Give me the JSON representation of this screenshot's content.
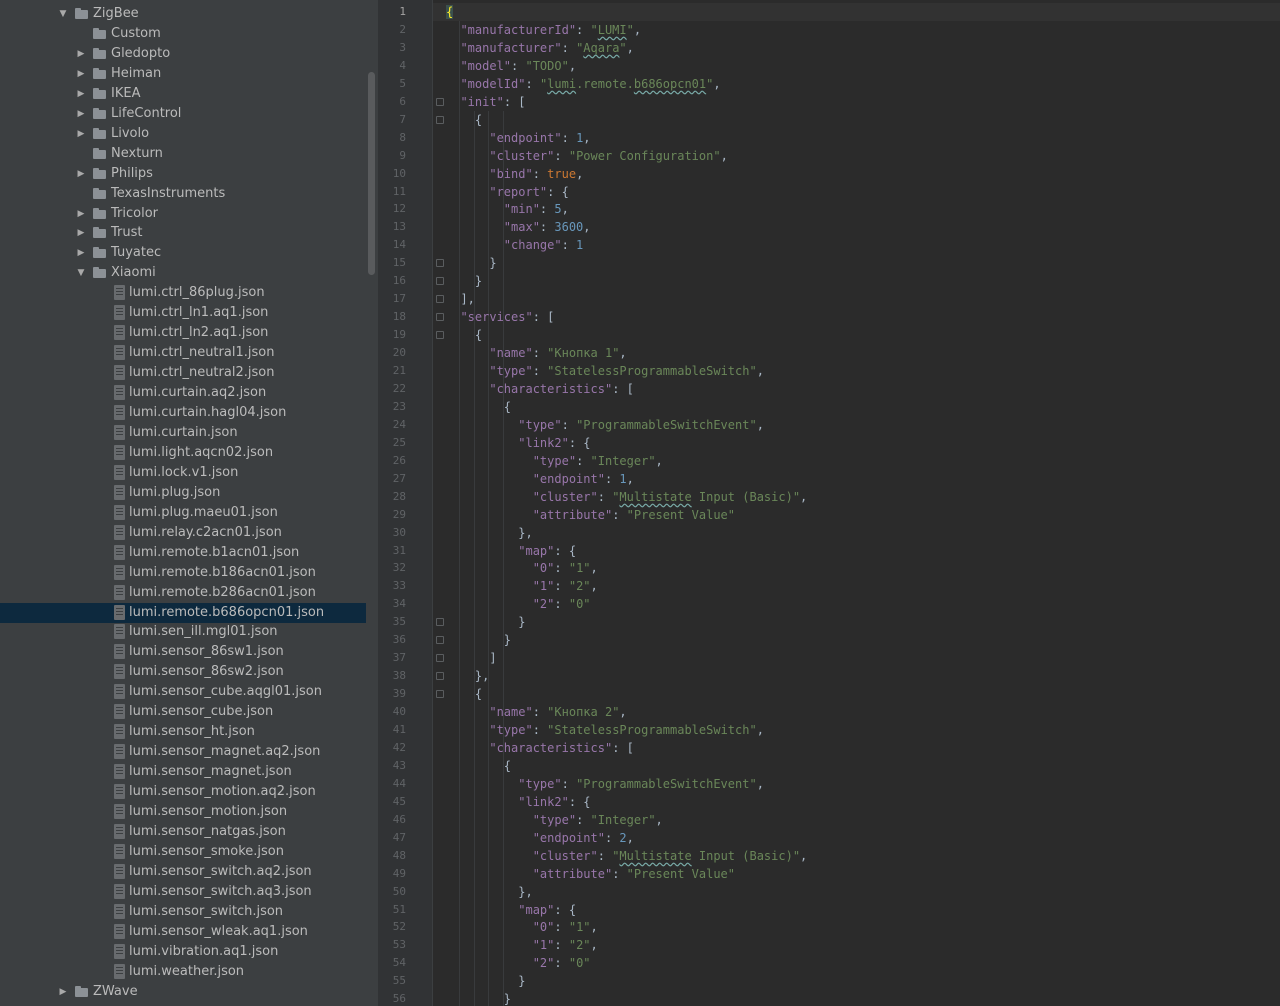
{
  "project_tree": {
    "items": [
      {
        "label": "ZigBee",
        "kind": "folder",
        "level": 0,
        "state": "expanded"
      },
      {
        "label": "Custom",
        "kind": "folder",
        "level": 1,
        "state": "leaf"
      },
      {
        "label": "Gledopto",
        "kind": "folder",
        "level": 1,
        "state": "collapsed"
      },
      {
        "label": "Heiman",
        "kind": "folder",
        "level": 1,
        "state": "collapsed"
      },
      {
        "label": "IKEA",
        "kind": "folder",
        "level": 1,
        "state": "collapsed"
      },
      {
        "label": "LifeControl",
        "kind": "folder",
        "level": 1,
        "state": "collapsed"
      },
      {
        "label": "Livolo",
        "kind": "folder",
        "level": 1,
        "state": "collapsed"
      },
      {
        "label": "Nexturn",
        "kind": "folder",
        "level": 1,
        "state": "leaf"
      },
      {
        "label": "Philips",
        "kind": "folder",
        "level": 1,
        "state": "collapsed"
      },
      {
        "label": "TexasInstruments",
        "kind": "folder",
        "level": 1,
        "state": "leaf"
      },
      {
        "label": "Tricolor",
        "kind": "folder",
        "level": 1,
        "state": "collapsed"
      },
      {
        "label": "Trust",
        "kind": "folder",
        "level": 1,
        "state": "collapsed"
      },
      {
        "label": "Tuyatec",
        "kind": "folder",
        "level": 1,
        "state": "collapsed"
      },
      {
        "label": "Xiaomi",
        "kind": "folder",
        "level": 1,
        "state": "expanded"
      },
      {
        "label": "lumi.ctrl_86plug.json",
        "kind": "file",
        "level": 2
      },
      {
        "label": "lumi.ctrl_ln1.aq1.json",
        "kind": "file",
        "level": 2
      },
      {
        "label": "lumi.ctrl_ln2.aq1.json",
        "kind": "file",
        "level": 2
      },
      {
        "label": "lumi.ctrl_neutral1.json",
        "kind": "file",
        "level": 2
      },
      {
        "label": "lumi.ctrl_neutral2.json",
        "kind": "file",
        "level": 2
      },
      {
        "label": "lumi.curtain.aq2.json",
        "kind": "file",
        "level": 2
      },
      {
        "label": "lumi.curtain.hagl04.json",
        "kind": "file",
        "level": 2
      },
      {
        "label": "lumi.curtain.json",
        "kind": "file",
        "level": 2
      },
      {
        "label": "lumi.light.aqcn02.json",
        "kind": "file",
        "level": 2
      },
      {
        "label": "lumi.lock.v1.json",
        "kind": "file",
        "level": 2
      },
      {
        "label": "lumi.plug.json",
        "kind": "file",
        "level": 2
      },
      {
        "label": "lumi.plug.maeu01.json",
        "kind": "file",
        "level": 2
      },
      {
        "label": "lumi.relay.c2acn01.json",
        "kind": "file",
        "level": 2
      },
      {
        "label": "lumi.remote.b1acn01.json",
        "kind": "file",
        "level": 2
      },
      {
        "label": "lumi.remote.b186acn01.json",
        "kind": "file",
        "level": 2
      },
      {
        "label": "lumi.remote.b286acn01.json",
        "kind": "file",
        "level": 2
      },
      {
        "label": "lumi.remote.b686opcn01.json",
        "kind": "file",
        "level": 2,
        "selected": true
      },
      {
        "label": "lumi.sen_ill.mgl01.json",
        "kind": "file",
        "level": 2
      },
      {
        "label": "lumi.sensor_86sw1.json",
        "kind": "file",
        "level": 2
      },
      {
        "label": "lumi.sensor_86sw2.json",
        "kind": "file",
        "level": 2
      },
      {
        "label": "lumi.sensor_cube.aqgl01.json",
        "kind": "file",
        "level": 2
      },
      {
        "label": "lumi.sensor_cube.json",
        "kind": "file",
        "level": 2
      },
      {
        "label": "lumi.sensor_ht.json",
        "kind": "file",
        "level": 2
      },
      {
        "label": "lumi.sensor_magnet.aq2.json",
        "kind": "file",
        "level": 2
      },
      {
        "label": "lumi.sensor_magnet.json",
        "kind": "file",
        "level": 2
      },
      {
        "label": "lumi.sensor_motion.aq2.json",
        "kind": "file",
        "level": 2
      },
      {
        "label": "lumi.sensor_motion.json",
        "kind": "file",
        "level": 2
      },
      {
        "label": "lumi.sensor_natgas.json",
        "kind": "file",
        "level": 2
      },
      {
        "label": "lumi.sensor_smoke.json",
        "kind": "file",
        "level": 2
      },
      {
        "label": "lumi.sensor_switch.aq2.json",
        "kind": "file",
        "level": 2
      },
      {
        "label": "lumi.sensor_switch.aq3.json",
        "kind": "file",
        "level": 2
      },
      {
        "label": "lumi.sensor_switch.json",
        "kind": "file",
        "level": 2
      },
      {
        "label": "lumi.sensor_wleak.aq1.json",
        "kind": "file",
        "level": 2
      },
      {
        "label": "lumi.vibration.aq1.json",
        "kind": "file",
        "level": 2
      },
      {
        "label": "lumi.weather.json",
        "kind": "file",
        "level": 2
      },
      {
        "label": "ZWave",
        "kind": "folder",
        "level": 0,
        "state": "collapsed"
      }
    ]
  },
  "editor": {
    "current_line": 1,
    "lines": [
      [
        [
          "{",
          "p"
        ]
      ],
      [
        [
          "  ",
          "p"
        ],
        [
          "\"manufacturerId\"",
          "k"
        ],
        [
          ": ",
          "p"
        ],
        [
          "\"LUMI\"",
          "s"
        ],
        [
          ",",
          "p"
        ]
      ],
      [
        [
          "  ",
          "p"
        ],
        [
          "\"manufacturer\"",
          "k"
        ],
        [
          ": ",
          "p"
        ],
        [
          "\"Aqara\"",
          "s"
        ],
        [
          ",",
          "p"
        ]
      ],
      [
        [
          "  ",
          "p"
        ],
        [
          "\"model\"",
          "k"
        ],
        [
          ": ",
          "p"
        ],
        [
          "\"TODO\"",
          "s"
        ],
        [
          ",",
          "p"
        ]
      ],
      [
        [
          "  ",
          "p"
        ],
        [
          "\"modelId\"",
          "k"
        ],
        [
          ": ",
          "p"
        ],
        [
          "\"lumi.remote.b686opcn01\"",
          "s"
        ],
        [
          ",",
          "p"
        ]
      ],
      [
        [
          "  ",
          "p"
        ],
        [
          "\"init\"",
          "k"
        ],
        [
          ": [",
          "p"
        ]
      ],
      [
        [
          "    {",
          "p"
        ]
      ],
      [
        [
          "      ",
          "p"
        ],
        [
          "\"endpoint\"",
          "k"
        ],
        [
          ": ",
          "p"
        ],
        [
          "1",
          "n"
        ],
        [
          ",",
          "p"
        ]
      ],
      [
        [
          "      ",
          "p"
        ],
        [
          "\"cluster\"",
          "k"
        ],
        [
          ": ",
          "p"
        ],
        [
          "\"Power Configuration\"",
          "s"
        ],
        [
          ",",
          "p"
        ]
      ],
      [
        [
          "      ",
          "p"
        ],
        [
          "\"bind\"",
          "k"
        ],
        [
          ": ",
          "p"
        ],
        [
          "true",
          "b"
        ],
        [
          ",",
          "p"
        ]
      ],
      [
        [
          "      ",
          "p"
        ],
        [
          "\"report\"",
          "k"
        ],
        [
          ": {",
          "p"
        ]
      ],
      [
        [
          "        ",
          "p"
        ],
        [
          "\"min\"",
          "k"
        ],
        [
          ": ",
          "p"
        ],
        [
          "5",
          "n"
        ],
        [
          ",",
          "p"
        ]
      ],
      [
        [
          "        ",
          "p"
        ],
        [
          "\"max\"",
          "k"
        ],
        [
          ": ",
          "p"
        ],
        [
          "3600",
          "n"
        ],
        [
          ",",
          "p"
        ]
      ],
      [
        [
          "        ",
          "p"
        ],
        [
          "\"change\"",
          "k"
        ],
        [
          ": ",
          "p"
        ],
        [
          "1",
          "n"
        ]
      ],
      [
        [
          "      }",
          "p"
        ]
      ],
      [
        [
          "    }",
          "p"
        ]
      ],
      [
        [
          "  ],",
          "p"
        ]
      ],
      [
        [
          "  ",
          "p"
        ],
        [
          "\"services\"",
          "k"
        ],
        [
          ": [",
          "p"
        ]
      ],
      [
        [
          "    {",
          "p"
        ]
      ],
      [
        [
          "      ",
          "p"
        ],
        [
          "\"name\"",
          "k"
        ],
        [
          ": ",
          "p"
        ],
        [
          "\"Кнопка 1\"",
          "s"
        ],
        [
          ",",
          "p"
        ]
      ],
      [
        [
          "      ",
          "p"
        ],
        [
          "\"type\"",
          "k"
        ],
        [
          ": ",
          "p"
        ],
        [
          "\"StatelessProgrammableSwitch\"",
          "s"
        ],
        [
          ",",
          "p"
        ]
      ],
      [
        [
          "      ",
          "p"
        ],
        [
          "\"characteristics\"",
          "k"
        ],
        [
          ": [",
          "p"
        ]
      ],
      [
        [
          "        {",
          "p"
        ]
      ],
      [
        [
          "          ",
          "p"
        ],
        [
          "\"type\"",
          "k"
        ],
        [
          ": ",
          "p"
        ],
        [
          "\"ProgrammableSwitchEvent\"",
          "s"
        ],
        [
          ",",
          "p"
        ]
      ],
      [
        [
          "          ",
          "p"
        ],
        [
          "\"link2\"",
          "k"
        ],
        [
          ": {",
          "p"
        ]
      ],
      [
        [
          "            ",
          "p"
        ],
        [
          "\"type\"",
          "k"
        ],
        [
          ": ",
          "p"
        ],
        [
          "\"Integer\"",
          "s"
        ],
        [
          ",",
          "p"
        ]
      ],
      [
        [
          "            ",
          "p"
        ],
        [
          "\"endpoint\"",
          "k"
        ],
        [
          ": ",
          "p"
        ],
        [
          "1",
          "n"
        ],
        [
          ",",
          "p"
        ]
      ],
      [
        [
          "            ",
          "p"
        ],
        [
          "\"cluster\"",
          "k"
        ],
        [
          ": ",
          "p"
        ],
        [
          "\"Multistate Input (Basic)\"",
          "s"
        ],
        [
          ",",
          "p"
        ]
      ],
      [
        [
          "            ",
          "p"
        ],
        [
          "\"attribute\"",
          "k"
        ],
        [
          ": ",
          "p"
        ],
        [
          "\"Present Value\"",
          "s"
        ]
      ],
      [
        [
          "          },",
          "p"
        ]
      ],
      [
        [
          "          ",
          "p"
        ],
        [
          "\"map\"",
          "k"
        ],
        [
          ": {",
          "p"
        ]
      ],
      [
        [
          "            ",
          "p"
        ],
        [
          "\"0\"",
          "k"
        ],
        [
          ": ",
          "p"
        ],
        [
          "\"1\"",
          "s"
        ],
        [
          ",",
          "p"
        ]
      ],
      [
        [
          "            ",
          "p"
        ],
        [
          "\"1\"",
          "k"
        ],
        [
          ": ",
          "p"
        ],
        [
          "\"2\"",
          "s"
        ],
        [
          ",",
          "p"
        ]
      ],
      [
        [
          "            ",
          "p"
        ],
        [
          "\"2\"",
          "k"
        ],
        [
          ": ",
          "p"
        ],
        [
          "\"0\"",
          "s"
        ]
      ],
      [
        [
          "          }",
          "p"
        ]
      ],
      [
        [
          "        }",
          "p"
        ]
      ],
      [
        [
          "      ]",
          "p"
        ]
      ],
      [
        [
          "    },",
          "p"
        ]
      ],
      [
        [
          "    {",
          "p"
        ]
      ],
      [
        [
          "      ",
          "p"
        ],
        [
          "\"name\"",
          "k"
        ],
        [
          ": ",
          "p"
        ],
        [
          "\"Кнопка 2\"",
          "s"
        ],
        [
          ",",
          "p"
        ]
      ],
      [
        [
          "      ",
          "p"
        ],
        [
          "\"type\"",
          "k"
        ],
        [
          ": ",
          "p"
        ],
        [
          "\"StatelessProgrammableSwitch\"",
          "s"
        ],
        [
          ",",
          "p"
        ]
      ],
      [
        [
          "      ",
          "p"
        ],
        [
          "\"characteristics\"",
          "k"
        ],
        [
          ": [",
          "p"
        ]
      ],
      [
        [
          "        {",
          "p"
        ]
      ],
      [
        [
          "          ",
          "p"
        ],
        [
          "\"type\"",
          "k"
        ],
        [
          ": ",
          "p"
        ],
        [
          "\"ProgrammableSwitchEvent\"",
          "s"
        ],
        [
          ",",
          "p"
        ]
      ],
      [
        [
          "          ",
          "p"
        ],
        [
          "\"link2\"",
          "k"
        ],
        [
          ": {",
          "p"
        ]
      ],
      [
        [
          "            ",
          "p"
        ],
        [
          "\"type\"",
          "k"
        ],
        [
          ": ",
          "p"
        ],
        [
          "\"Integer\"",
          "s"
        ],
        [
          ",",
          "p"
        ]
      ],
      [
        [
          "            ",
          "p"
        ],
        [
          "\"endpoint\"",
          "k"
        ],
        [
          ": ",
          "p"
        ],
        [
          "2",
          "n"
        ],
        [
          ",",
          "p"
        ]
      ],
      [
        [
          "            ",
          "p"
        ],
        [
          "\"cluster\"",
          "k"
        ],
        [
          ": ",
          "p"
        ],
        [
          "\"Multistate Input (Basic)\"",
          "s"
        ],
        [
          ",",
          "p"
        ]
      ],
      [
        [
          "            ",
          "p"
        ],
        [
          "\"attribute\"",
          "k"
        ],
        [
          ": ",
          "p"
        ],
        [
          "\"Present Value\"",
          "s"
        ]
      ],
      [
        [
          "          },",
          "p"
        ]
      ],
      [
        [
          "          ",
          "p"
        ],
        [
          "\"map\"",
          "k"
        ],
        [
          ": {",
          "p"
        ]
      ],
      [
        [
          "            ",
          "p"
        ],
        [
          "\"0\"",
          "k"
        ],
        [
          ": ",
          "p"
        ],
        [
          "\"1\"",
          "s"
        ],
        [
          ",",
          "p"
        ]
      ],
      [
        [
          "            ",
          "p"
        ],
        [
          "\"1\"",
          "k"
        ],
        [
          ": ",
          "p"
        ],
        [
          "\"2\"",
          "s"
        ],
        [
          ",",
          "p"
        ]
      ],
      [
        [
          "            ",
          "p"
        ],
        [
          "\"2\"",
          "k"
        ],
        [
          ": ",
          "p"
        ],
        [
          "\"0\"",
          "s"
        ]
      ],
      [
        [
          "          }",
          "p"
        ]
      ],
      [
        [
          "        }",
          "p"
        ]
      ]
    ],
    "fold_lines": [
      1,
      6,
      7,
      15,
      16,
      17,
      18,
      19,
      35,
      36,
      37,
      38,
      39
    ]
  },
  "colors": {
    "tree_bg": "#3c3f41",
    "editor_bg": "#2b2b2b",
    "selection": "#0d293e",
    "key": "#9876aa",
    "string": "#6a8759",
    "number": "#6897bb",
    "boolean": "#cc7832"
  },
  "icons": {
    "folder": "folder-icon",
    "file": "json-file-icon",
    "expanded": "triangle-down-icon",
    "collapsed": "triangle-right-icon"
  }
}
